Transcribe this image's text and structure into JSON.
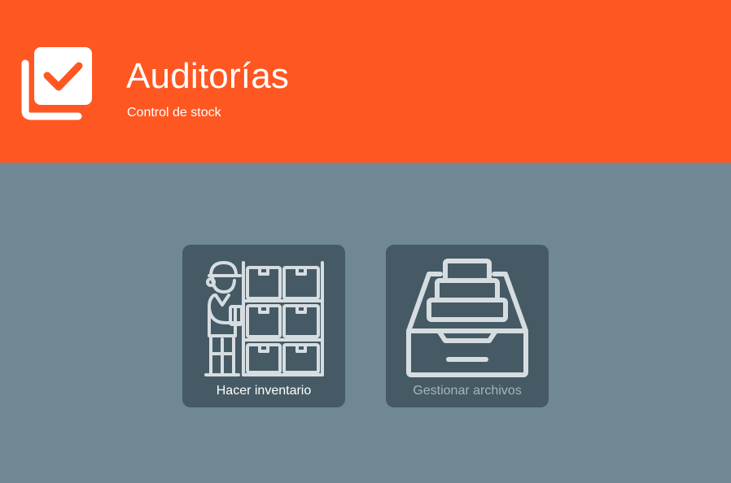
{
  "header": {
    "title": "Auditorías",
    "subtitle": "Control de stock",
    "logo_icon": "checked-layers-icon"
  },
  "actions": [
    {
      "label": "Hacer inventario",
      "icon": "warehouse-worker-icon",
      "enabled": true
    },
    {
      "label": "Gestionar archivos",
      "icon": "file-drawer-icon",
      "enabled": false
    }
  ],
  "colors": {
    "header_bg": "#ff5722",
    "page_bg": "#708893",
    "card_bg": "#455a64",
    "icon_stroke": "#d6dde1",
    "disabled_text": "#a8b4ba"
  }
}
